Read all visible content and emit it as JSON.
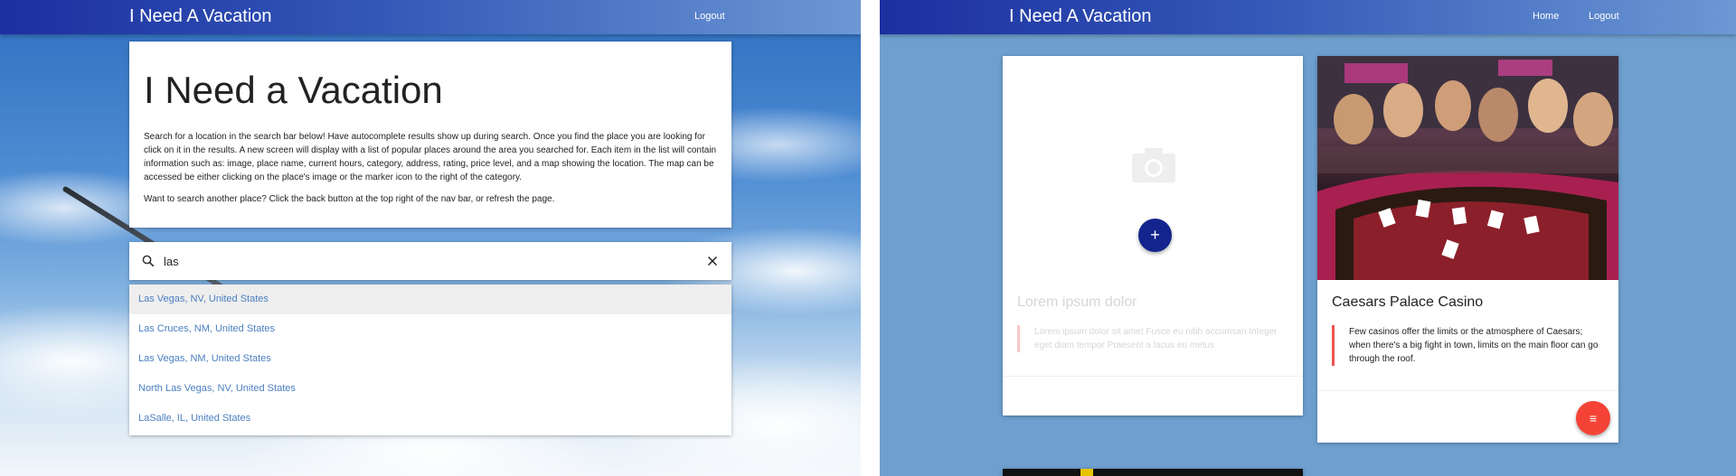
{
  "left": {
    "navbar": {
      "brand": "I Need A Vacation",
      "logout": "Logout"
    },
    "intro": {
      "heading": "I Need a Vacation",
      "paragraph1": "Search for a location in the search bar below! Have autocomplete results show up during search. Once you find the place you are looking for click on it in the results. A new screen will display with a list of popular places around the area you searched for. Each item in the list will contain information such as: image, place name, current hours, category, address, rating, price level, and a map showing the location. The map can be accessed be either clicking on the place's image or the marker icon to the right of the category.",
      "paragraph2": "Want to search another place? Click the back button at the top right of the nav bar, or refresh the page."
    },
    "search": {
      "value": "las"
    },
    "results": [
      "Las Vegas, NV, United States",
      "Las Cruces, NM, United States",
      "Las Vegas, NM, United States",
      "North Las Vegas, NV, United States",
      "LaSalle, IL, United States"
    ]
  },
  "right": {
    "navbar": {
      "brand": "I Need A Vacation",
      "home": "Home",
      "logout": "Logout"
    },
    "placeholder_card": {
      "title": "Lorem ipsum dolor",
      "text": "Lorem ipsum dolor sit amet Fusce eu nibh accumsan Integer eget diam tempor Praesent a lacus eu metus",
      "add_icon": "+"
    },
    "casino_card": {
      "title": "Caesars Palace Casino",
      "text": "Few casinos offer the limits or the atmosphere of Caesars; when there's a big fight in town, limits on the main floor can go through the roof.",
      "menu_icon": "≡"
    }
  },
  "colors": {
    "navbar_start": "#1c2fa0",
    "navbar_end": "#6c98d4",
    "right_background": "#6e9fce",
    "result_link": "#4a7fc0",
    "fab_add": "#13248e",
    "fab_menu": "#f44336",
    "quote_border_faded": "#f7c9c9",
    "quote_border": "#ef5350"
  }
}
